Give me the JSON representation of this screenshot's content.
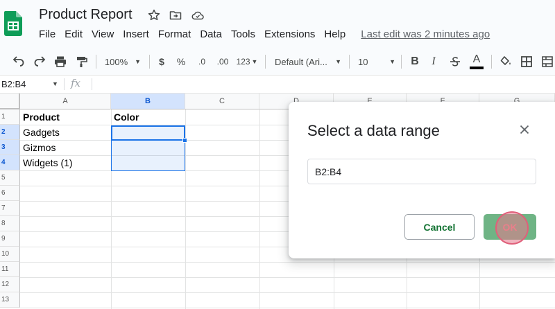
{
  "document": {
    "title": "Product Report",
    "star_icon": "star-icon",
    "move_icon": "folder-move-icon",
    "cloud_icon": "cloud-status-icon"
  },
  "menu": {
    "items": [
      "File",
      "Edit",
      "View",
      "Insert",
      "Format",
      "Data",
      "Tools",
      "Extensions",
      "Help"
    ],
    "last_edit": "Last edit was 2 minutes ago"
  },
  "toolbar": {
    "zoom": "100%",
    "currency": "$",
    "percent": "%",
    "decrease_decimal": ".0",
    "increase_decimal": ".00",
    "more_formats": "123",
    "font": "Default (Ari...",
    "font_size": "10",
    "bold": "B",
    "italic": "I",
    "text_color_letter": "A"
  },
  "formula_bar": {
    "name_box": "B2:B4",
    "fx": "fx",
    "value": ""
  },
  "sheet": {
    "columns": [
      "A",
      "B",
      "C",
      "D",
      "E",
      "F",
      "G"
    ],
    "rows": [
      "1",
      "2",
      "3",
      "4",
      "5",
      "6",
      "7",
      "8",
      "9",
      "10",
      "11",
      "12",
      "13"
    ],
    "cells": {
      "A1": "Product",
      "B1": "Color",
      "A2": "Gadgets",
      "A3": "Gizmos",
      "A4": "Widgets (1)"
    },
    "selection": "B2:B4"
  },
  "dialog": {
    "title": "Select a data range",
    "range_value": "B2:B4",
    "cancel_label": "Cancel",
    "ok_label": "OK"
  },
  "colors": {
    "sheets_green": "#0f9d58",
    "selection_blue": "#1a73e8",
    "ok_button": "#6fb485",
    "cancel_text": "#137333",
    "click_indicator": "#e0607a"
  }
}
